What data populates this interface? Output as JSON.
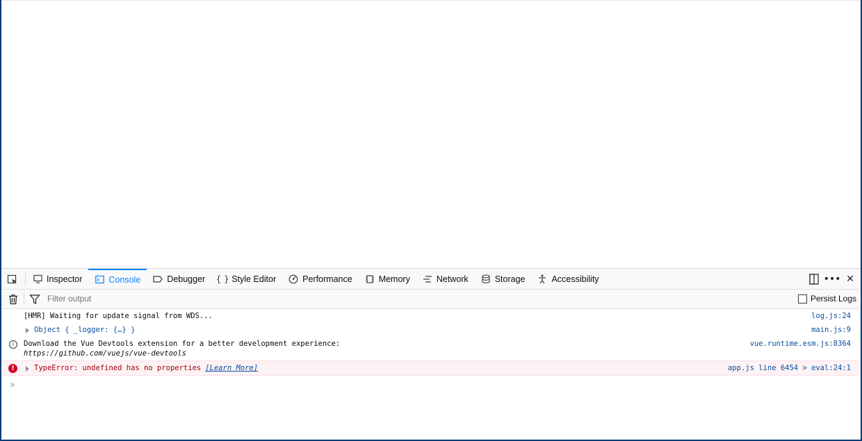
{
  "tabs": [
    {
      "label": "Inspector",
      "icon": "inspector-icon"
    },
    {
      "label": "Console",
      "icon": "console-icon"
    },
    {
      "label": "Debugger",
      "icon": "debugger-icon"
    },
    {
      "label": "Style Editor",
      "icon": "style-editor-icon"
    },
    {
      "label": "Performance",
      "icon": "performance-icon"
    },
    {
      "label": "Memory",
      "icon": "memory-icon"
    },
    {
      "label": "Network",
      "icon": "network-icon"
    },
    {
      "label": "Storage",
      "icon": "storage-icon"
    },
    {
      "label": "Accessibility",
      "icon": "accessibility-icon"
    }
  ],
  "active_tab": "Console",
  "filter": {
    "placeholder": "Filter output",
    "value": ""
  },
  "persist_logs": {
    "label": "Persist Logs",
    "checked": false
  },
  "messages": [
    {
      "text": "[HMR] Waiting for update signal from WDS...",
      "location": "log.js:24"
    },
    {
      "text": "Object { _logger: {…} }",
      "location": "main.js:9"
    },
    {
      "line1": "Download the Vue Devtools extension for a better development experience:",
      "line2": "https://github.com/vuejs/vue-devtools",
      "location": "vue.runtime.esm.js:8364"
    },
    {
      "text": "TypeError: undefined has no properties",
      "link": "[Learn More]",
      "location": "app.js line 6454 > eval:24:1"
    }
  ],
  "colors": {
    "accent": "#0a84ff",
    "error": "#d70022",
    "link": "#0a4ea0",
    "window_frame": "#0a3d74"
  }
}
